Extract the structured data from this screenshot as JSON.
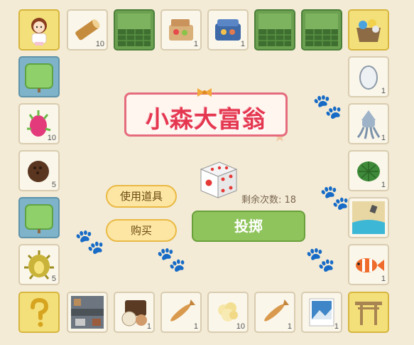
{
  "title": "小森大富翁",
  "buttons": {
    "use_item": "使用道具",
    "buy": "购买",
    "roll": "投掷"
  },
  "status": {
    "remaining_label": "剩余次数:",
    "remaining_value": "18"
  },
  "dice_face": 4,
  "tiles": {
    "top": [
      {
        "name": "character-avatar",
        "count": ""
      },
      {
        "name": "wood-log",
        "count": "10"
      },
      {
        "name": "fence",
        "count": ""
      },
      {
        "name": "lunch-box",
        "count": "1"
      },
      {
        "name": "cookie-tin",
        "count": "1"
      },
      {
        "name": "fence",
        "count": ""
      },
      {
        "name": "fence",
        "count": ""
      },
      {
        "name": "toy-basket",
        "count": ""
      }
    ],
    "right": [
      {
        "name": "egg",
        "count": "1"
      },
      {
        "name": "squid",
        "count": "1"
      },
      {
        "name": "turtle",
        "count": "1"
      },
      {
        "name": "beach",
        "count": ""
      },
      {
        "name": "clownfish",
        "count": "1"
      }
    ],
    "left": [
      {
        "name": "grass-pad",
        "count": ""
      },
      {
        "name": "dragon-fruit",
        "count": "10"
      },
      {
        "name": "coconut",
        "count": "5"
      },
      {
        "name": "grass-pad",
        "count": ""
      },
      {
        "name": "durian",
        "count": "5"
      }
    ],
    "bottom": [
      {
        "name": "question-mark",
        "count": ""
      },
      {
        "name": "street-map",
        "count": ""
      },
      {
        "name": "bento",
        "count": "1"
      },
      {
        "name": "dried-fish",
        "count": "1"
      },
      {
        "name": "popcorn",
        "count": "10"
      },
      {
        "name": "dried-fish",
        "count": "1"
      },
      {
        "name": "photo",
        "count": "1"
      },
      {
        "name": "torii-gate",
        "count": ""
      }
    ]
  }
}
